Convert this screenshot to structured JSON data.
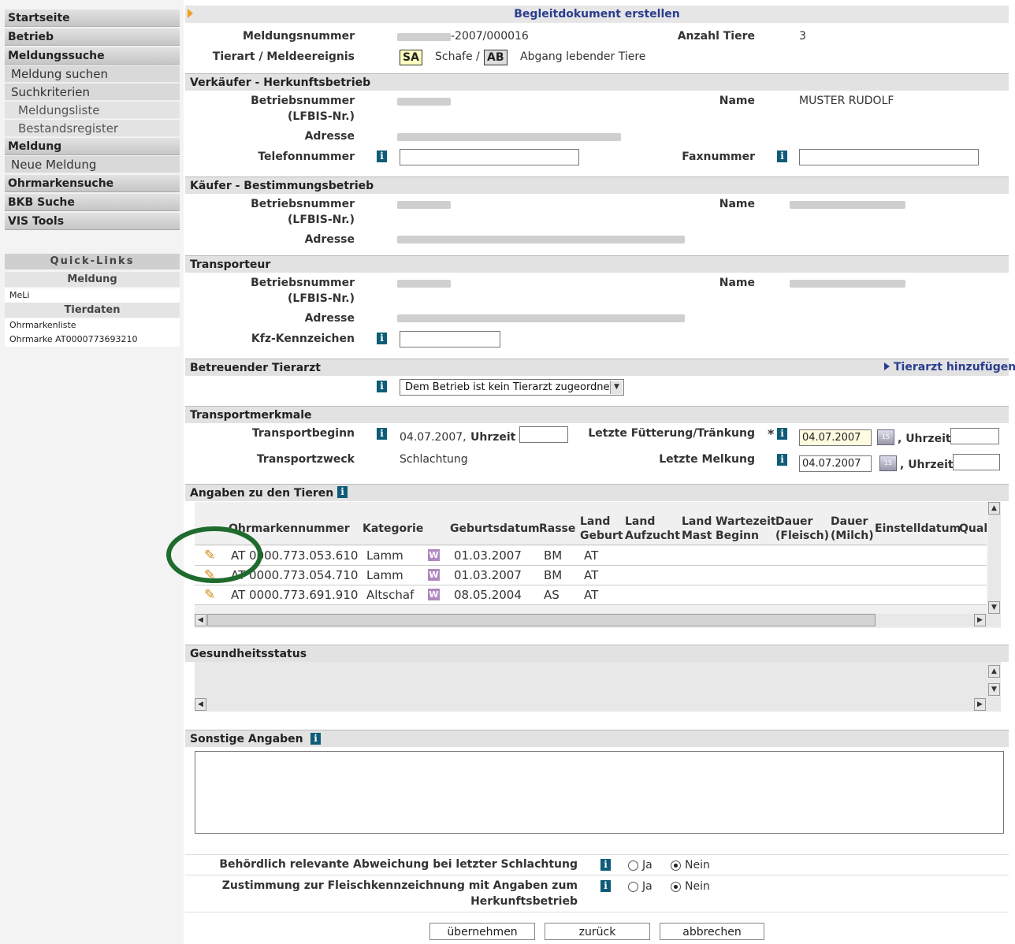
{
  "sidebar": {
    "nav": [
      "Startseite",
      "Betrieb",
      "Meldungssuche"
    ],
    "sub_meldungssuche": [
      "Meldung suchen",
      "Suchkriterien"
    ],
    "sub2_suchkriterien": [
      "Meldungsliste",
      "Bestandsregister"
    ],
    "meldung": "Meldung",
    "neue_meldung": "Neue Meldung",
    "nav2": [
      "Ohrmarkensuche",
      "BKB Suche",
      "VIS Tools"
    ],
    "quicklinks": {
      "title": "Quick-Links",
      "meldung": "Meldung",
      "meli": "MeLi",
      "tierdaten": "Tierdaten",
      "ohrmarkenliste": "Ohrmarkenliste",
      "ohrmarke": "Ohrmarke AT0000773693210"
    }
  },
  "header": {
    "title": "Begleitdokument erstellen"
  },
  "top": {
    "meldungsnummer_label": "Meldungsnummer",
    "meldungsnummer_value": "-2007/000016",
    "anzahl_label": "Anzahl Tiere",
    "anzahl_value": "3",
    "tierart_label": "Tierart / Meldeereignis",
    "tag_sa": "SA",
    "schafe": "Schafe /",
    "tag_ab": "AB",
    "abgang": "Abgang lebender Tiere"
  },
  "verkaeufer": {
    "title": "Verkäufer - Herkunftsbetrieb",
    "betriebsnummer": "Betriebsnummer",
    "lfbis": "(LFBIS-Nr.)",
    "name_label": "Name",
    "name_value": "MUSTER RUDOLF",
    "adresse": "Adresse",
    "telefon": "Telefonnummer",
    "fax": "Faxnummer"
  },
  "kaeufer": {
    "title": "Käufer - Bestimmungsbetrieb",
    "betriebsnummer": "Betriebsnummer",
    "lfbis": "(LFBIS-Nr.)",
    "name_label": "Name",
    "adresse": "Adresse"
  },
  "transporteur": {
    "title": "Transporteur",
    "betriebsnummer": "Betriebsnummer",
    "lfbis": "(LFBIS-Nr.)",
    "name_label": "Name",
    "adresse": "Adresse",
    "kfz": "Kfz-Kennzeichen"
  },
  "tierarzt": {
    "title": "Betreuender Tierarzt",
    "add_link": "Tierarzt hinzufügen",
    "select_value": "Dem Betrieb ist kein Tierarzt zugeordnet"
  },
  "transport": {
    "title": "Transportmerkmale",
    "beginn_label": "Transportbeginn",
    "beginn_date": "04.07.2007,",
    "uhrzeit": "Uhrzeit",
    "fuetterung_label": "Letzte Fütterung/Tränkung",
    "star": "*",
    "fuetterung_date": "04.07.2007",
    "zweck_label": "Transportzweck",
    "zweck_value": "Schlachtung",
    "melkung_label": "Letzte Melkung",
    "melkung_date": "04.07.2007",
    "comma_uhrzeit": ", Uhrzeit"
  },
  "tiere": {
    "title": "Angaben zu den Tieren",
    "headers": {
      "ohrmarke": "Ohrmarkennummer",
      "kategorie": "Kategorie",
      "geburtsdatum": "Geburtsdatum",
      "rasse": "Rasse",
      "land1": "Land",
      "geburt": "Geburt",
      "land2": "Land",
      "aufzucht": "Aufzucht",
      "land3": "Land",
      "mast": "Mast",
      "wartezeit": "Wartezeit",
      "beginn": "Beginn",
      "dauer1": "Dauer",
      "fleisch": "(Fleisch)",
      "dauer2": "Dauer",
      "milch": "(Milch)",
      "einstelldatum": "Einstelldatum",
      "quali": "Quali"
    },
    "rows": [
      {
        "ohrmarke": "AT 0000.773.053.610",
        "kategorie": "Lamm",
        "w": "W",
        "geburtsdatum": "01.03.2007",
        "rasse": "BM",
        "land": "AT"
      },
      {
        "ohrmarke": "AT 0000.773.054.710",
        "kategorie": "Lamm",
        "w": "W",
        "geburtsdatum": "01.03.2007",
        "rasse": "BM",
        "land": "AT"
      },
      {
        "ohrmarke": "AT 0000.773.691.910",
        "kategorie": "Altschaf",
        "w": "W",
        "geburtsdatum": "08.05.2004",
        "rasse": "AS",
        "land": "AT"
      }
    ]
  },
  "gesundheit": {
    "title": "Gesundheitsstatus"
  },
  "sonstige": {
    "title": "Sonstige Angaben"
  },
  "questions": {
    "q1": "Behördlich relevante Abweichung bei letzter Schlachtung",
    "q2a": "Zustimmung zur Fleischkennzeichnung mit Angaben zum",
    "q2b": "Herkunftsbetrieb",
    "ja": "Ja",
    "nein": "Nein"
  },
  "buttons": {
    "ok": "übernehmen",
    "back": "zurück",
    "cancel": "abbrechen"
  },
  "colors": {
    "info": "#0e5c78",
    "link": "#2a3d8f",
    "highlight_circle": "#1f6b2e"
  }
}
